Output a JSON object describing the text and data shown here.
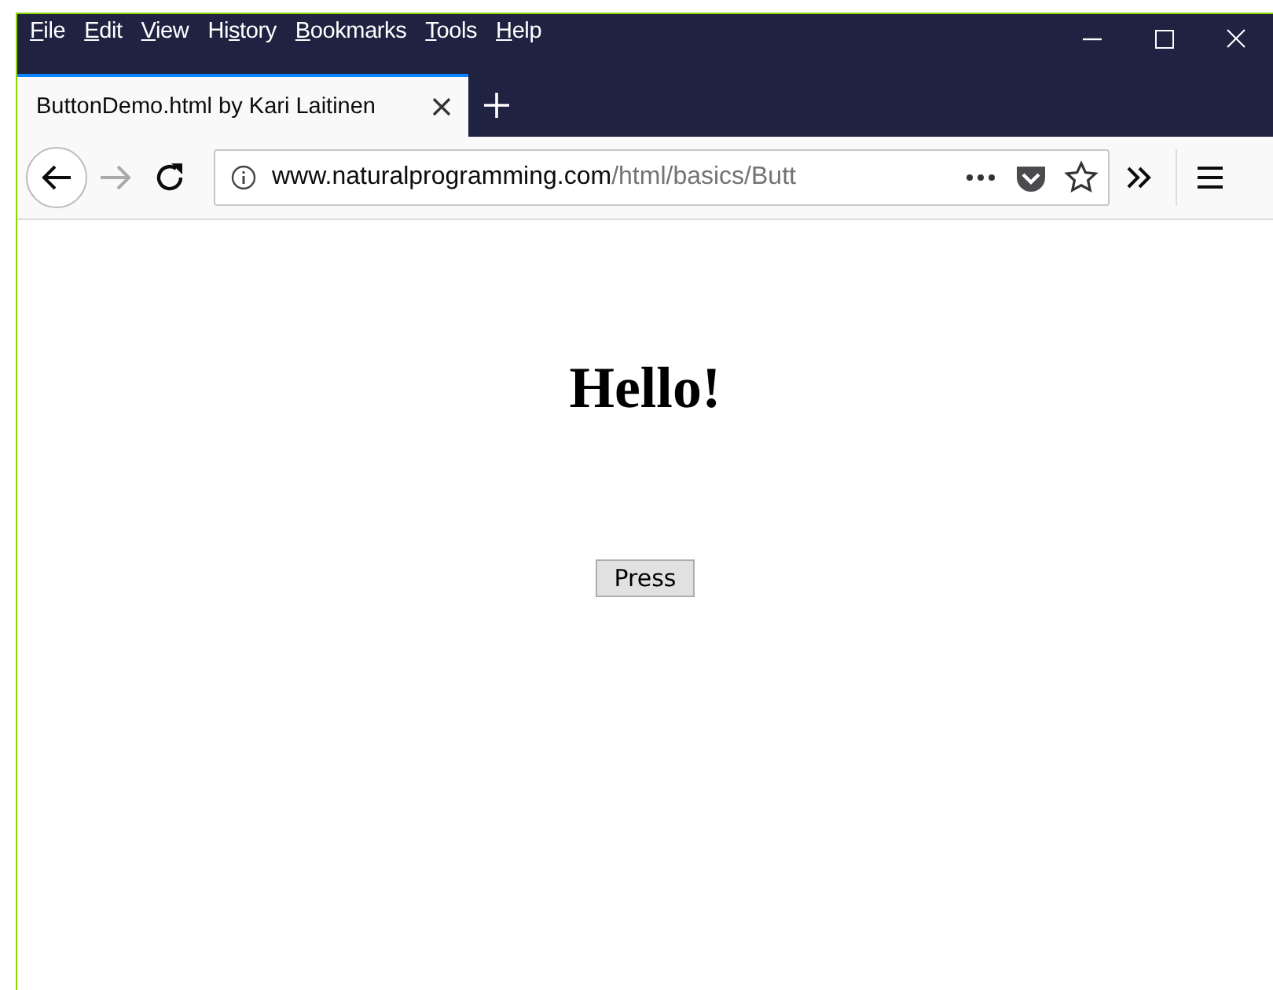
{
  "menu": [
    {
      "key": "F",
      "after": "ile"
    },
    {
      "key": "E",
      "after": "dit"
    },
    {
      "key": "V",
      "after": "iew"
    },
    {
      "before": "Hi",
      "key": "s",
      "after": "tory"
    },
    {
      "key": "B",
      "after": "ookmarks"
    },
    {
      "key": "T",
      "after": "ools"
    },
    {
      "key": "H",
      "after": "elp"
    }
  ],
  "tabs": [
    {
      "label": "ButtonDemo.html by Kari Laitinen",
      "selected": true
    }
  ],
  "address": {
    "domain": "www.naturalprogramming.com",
    "path": "/html/basics/Butt"
  },
  "page": {
    "heading": "Hello!",
    "button": "Press"
  }
}
